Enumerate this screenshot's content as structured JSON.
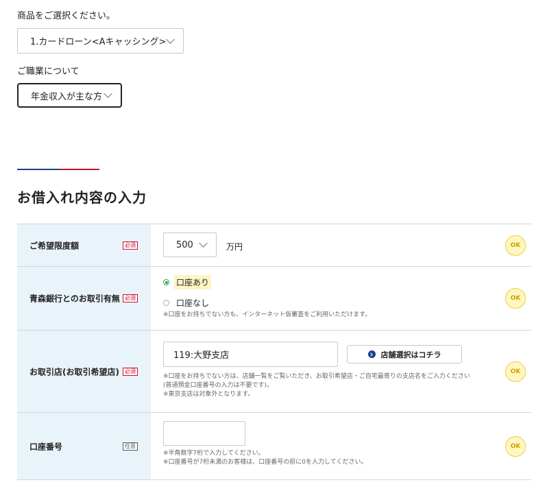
{
  "product": {
    "label": "商品をご選択ください。",
    "selected": "1.カードローン<Aキャッシング>"
  },
  "occupation": {
    "label": "ご職業について",
    "selected": "年金収入が主な方"
  },
  "section": {
    "title": "お借入れ内容の入力"
  },
  "rows": {
    "limit": {
      "label": "ご希望限度額",
      "badge": "必須",
      "value": "500",
      "unit": "万円",
      "status": "OK"
    },
    "relation": {
      "label": "青森銀行とのお取引有無",
      "badge": "必須",
      "option_yes": "口座あり",
      "option_no": "口座なし",
      "selected": "口座あり",
      "note": "※口座をお持ちでない方も、インターネット仮審査をご利用いただけます。",
      "status": "OK"
    },
    "branch": {
      "label": "お取引店(お取引希望店)",
      "badge": "必須",
      "value": "119:大野支店",
      "button": "店舗選択はコチラ",
      "note1": "※口座をお持ちでない方は、店舗一覧をご覧いただき、お取引希望店・ご自宅最寄りの支店名をご入力ください",
      "note2": "(普通預金口座番号の入力は不要です)。",
      "note3": "※東京支店は対象外となります。",
      "status": "OK"
    },
    "account": {
      "label": "口座番号",
      "badge": "任意",
      "value": "",
      "note1": "※半角数字7桁で入力してください。",
      "note2": "※口座番号が7桁未満のお客様は、口座番号の前に0を入力してください。",
      "status": "OK"
    }
  },
  "colors": {
    "header_bg": "#e9f3fa",
    "required": "#c8102e",
    "accent_blue": "#1b3e8c",
    "ok_bg": "#fff7c2",
    "ok_text": "#d69a00",
    "radio_on": "#2aa84a"
  }
}
